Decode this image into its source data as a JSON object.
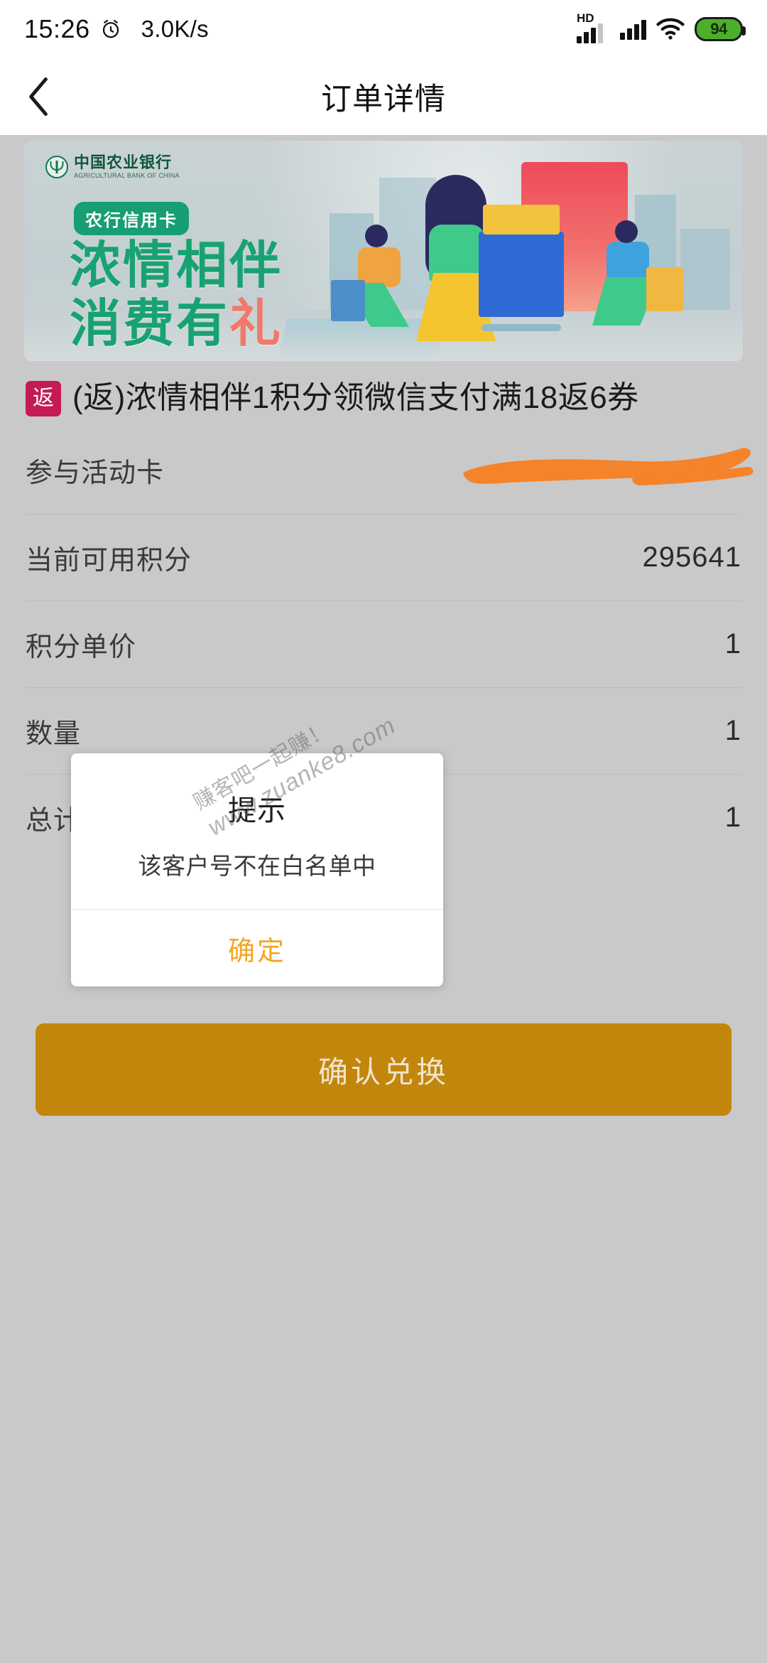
{
  "status_bar": {
    "time": "15:26",
    "network_speed": "3.0K/s",
    "hd_label": "HD",
    "battery_level": "94",
    "icons": [
      "alarm-icon",
      "hd-signal-icon",
      "signal-icon",
      "wifi-icon",
      "battery-icon"
    ]
  },
  "nav": {
    "title": "订单详情",
    "back_icon": "chevron-left-icon"
  },
  "banner": {
    "bank_name_cn": "中国农业银行",
    "bank_name_en": "AGRICULTURAL BANK OF CHINA",
    "tag": "农行信用卡",
    "headline_line1": "浓情相伴",
    "headline_line2_main": "消费有",
    "headline_line2_accent": "礼",
    "coin_symbol": "¥"
  },
  "product": {
    "badge": "返",
    "title": "(返)浓情相伴1积分领微信支付满18返6券"
  },
  "details": [
    {
      "label": "参与活动卡",
      "value": "",
      "redacted": true
    },
    {
      "label": "当前可用积分",
      "value": "295641",
      "redacted": false
    },
    {
      "label": "积分单价",
      "value": "1",
      "redacted": false
    },
    {
      "label": "数量",
      "value": "1",
      "redacted": false
    },
    {
      "label": "总计",
      "value": "1",
      "redacted": false
    }
  ],
  "cta": {
    "label": "确认兑换"
  },
  "dialog": {
    "title": "提示",
    "message": "该客户号不在白名单中",
    "confirm_label": "确定"
  },
  "watermark": {
    "line1": "赚客吧一起赚！",
    "line2": "www.zuanke8.com"
  },
  "colors": {
    "accent_orange": "#f5a623",
    "cta_gold": "#c2860b",
    "badge_crimson": "#c41c52",
    "bank_green": "#18a272",
    "redact_orange": "#f5832a"
  }
}
